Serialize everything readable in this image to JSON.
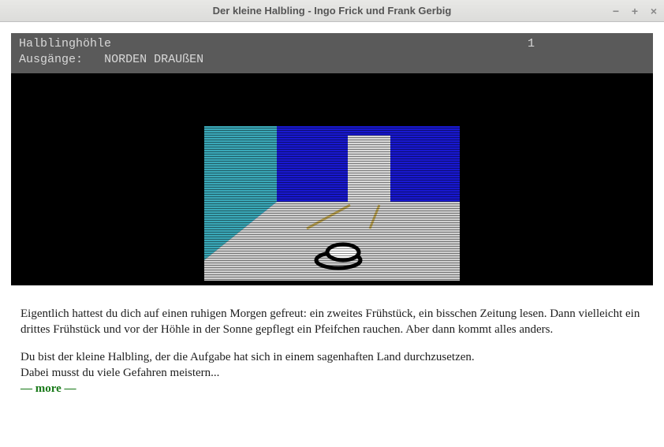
{
  "window": {
    "title": "Der kleine Halbling - Ingo Frick und Frank Gerbig",
    "controls": {
      "min": "−",
      "max": "+",
      "close": "×"
    }
  },
  "status": {
    "location": "Halblinghöhle",
    "score": "1",
    "exits_label": "Ausgänge:",
    "exits": "NORDEN   DRAUßEN"
  },
  "story": {
    "p1": "Eigentlich hattest du dich auf einen ruhigen Morgen gefreut: ein zweites Frühstück, ein bisschen Zeitung lesen. Dann vielleicht ein drittes Frühstück und vor der Höhle in der Sonne gepflegt ein Pfeifchen rauchen. Aber dann kommt alles anders.",
    "p2": "Du bist der kleine Halbling, der die Aufgabe hat sich in einem sagenhaften Land durchzusetzen.",
    "p3": "Dabei musst du viele Gefahren meistern...",
    "more": "— more —"
  },
  "scene": {
    "colors": {
      "left_wall": "#3aa8b8",
      "back_wall": "#1818d0",
      "floor": "#d0d0d0",
      "door": "#d8d8d8",
      "scanline": "#000000",
      "item_outline": "#000"
    }
  }
}
